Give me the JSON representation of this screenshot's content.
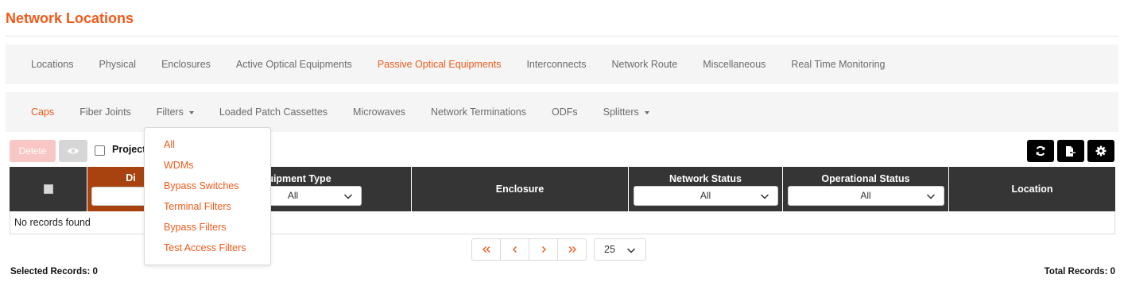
{
  "page": {
    "title": "Network Locations"
  },
  "colors": {
    "accent": "#f05a1a",
    "header_dark": "#353535",
    "header_sorted": "#a84310",
    "delete_disabled": "#f8c6c4"
  },
  "main_nav": {
    "items": [
      {
        "label": "Locations"
      },
      {
        "label": "Physical"
      },
      {
        "label": "Enclosures"
      },
      {
        "label": "Active Optical Equipments"
      },
      {
        "label": "Passive Optical Equipments",
        "active": true
      },
      {
        "label": "Interconnects"
      },
      {
        "label": "Network Route"
      },
      {
        "label": "Miscellaneous"
      },
      {
        "label": "Real Time Monitoring"
      }
    ]
  },
  "sub_nav": {
    "items": [
      {
        "label": "Caps",
        "active": true
      },
      {
        "label": "Fiber Joints"
      },
      {
        "label": "Filters",
        "dropdown": true
      },
      {
        "label": "Loaded Patch Cassettes"
      },
      {
        "label": "Microwaves"
      },
      {
        "label": "Network Terminations"
      },
      {
        "label": "ODFs"
      },
      {
        "label": "Splitters",
        "dropdown": true
      }
    ]
  },
  "filters_menu": {
    "items": [
      {
        "label": "All"
      },
      {
        "label": "WDMs"
      },
      {
        "label": "Bypass Switches"
      },
      {
        "label": "Terminal Filters"
      },
      {
        "label": "Bypass Filters"
      },
      {
        "label": "Test Access Filters"
      }
    ]
  },
  "toolbar": {
    "delete_label": "Delete",
    "view_icon": "eye-icon",
    "project_label": "Project",
    "refresh_icon": "refresh-icon",
    "export_icon": "export-icon",
    "settings_icon": "gear-icon"
  },
  "grid": {
    "columns": [
      {
        "label": "",
        "type": "checkbox"
      },
      {
        "label": "Di",
        "type": "text-filter",
        "sorted": true
      },
      {
        "label": "Equipment Type",
        "filter_value": "All"
      },
      {
        "label": "Enclosure"
      },
      {
        "label": "Network Status",
        "filter_value": "All"
      },
      {
        "label": "Operational Status",
        "filter_value": "All"
      },
      {
        "label": "Location"
      }
    ],
    "empty_message": "No records found"
  },
  "pagination": {
    "first": "«",
    "prev": "‹",
    "next": "›",
    "last": "»",
    "page_size": "25"
  },
  "footer": {
    "selected_records": "Selected Records: 0",
    "total_records": "Total Records: 0"
  }
}
